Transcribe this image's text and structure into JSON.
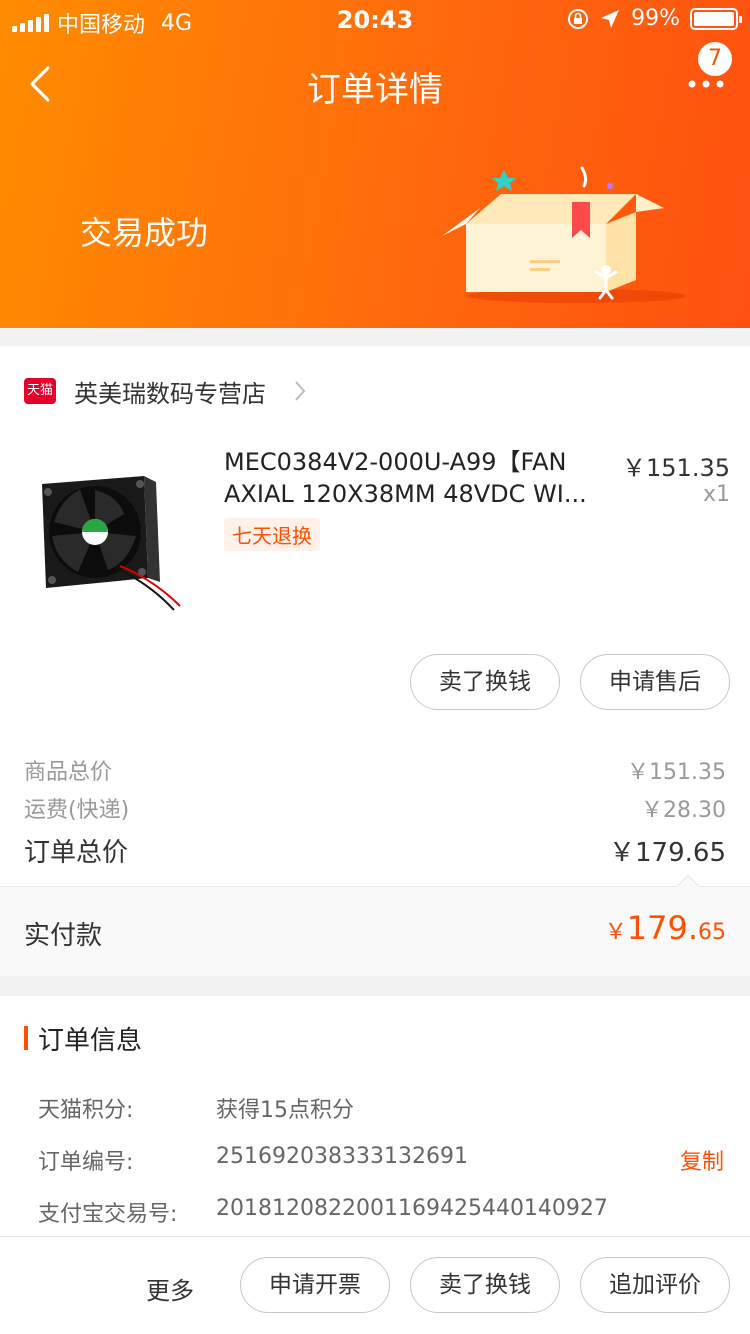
{
  "status_bar": {
    "carrier": "中国移动",
    "network": "4G",
    "time": "20:43",
    "battery": "99%"
  },
  "nav": {
    "title": "订单详情",
    "badge_count": "7"
  },
  "header": {
    "status_text": "交易成功"
  },
  "shop": {
    "logo_text": "天猫",
    "name": "英美瑞数码专营店"
  },
  "product": {
    "title": "MEC0384V2-000U-A99【FAN AXIAL 120X38MM 48VDC WI...",
    "service_tag": "七天退换",
    "price": "￥151.35",
    "quantity": "x1",
    "buttons": {
      "sell": "卖了换钱",
      "after_sale": "申请售后"
    }
  },
  "summary": {
    "goods_total_label": "商品总价",
    "goods_total_value": "￥151.35",
    "shipping_label": "运费(快递)",
    "shipping_value": "￥28.30",
    "order_total_label": "订单总价",
    "order_total_value": "￥179.65",
    "paid_label": "实付款",
    "paid_currency": "￥",
    "paid_integer": "179.",
    "paid_decimal": "65"
  },
  "order_info": {
    "title": "订单信息",
    "rows": [
      {
        "key": "天猫积分:",
        "value": "获得15点积分"
      },
      {
        "key": "订单编号:",
        "value": "251692038333132691"
      },
      {
        "key": "支付宝交易号:",
        "value": "2018120822001169425440140927"
      }
    ],
    "copy_label": "复制"
  },
  "bottom_bar": {
    "more": "更多",
    "invoice": "申请开票",
    "sell": "卖了换钱",
    "review": "追加评价"
  },
  "colors": {
    "accent": "#ff5000",
    "header_start": "#ff8c00",
    "header_end": "#ff5010"
  }
}
